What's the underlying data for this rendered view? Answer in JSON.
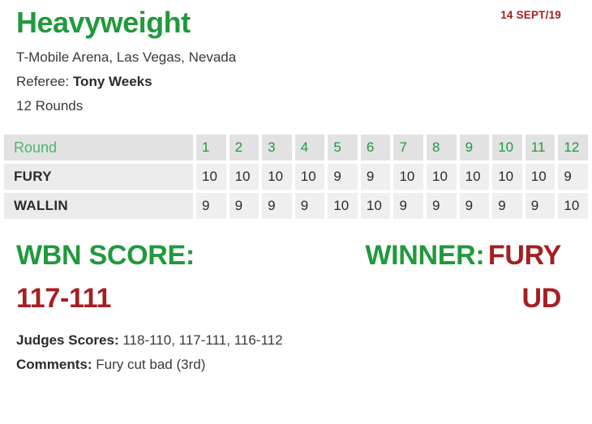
{
  "header": {
    "title": "Heavyweight",
    "date": "14 SEPT/19",
    "venue": "T-Mobile Arena, Las Vegas, Nevada",
    "referee_label": "Referee:",
    "referee_name": "Tony Weeks",
    "rounds": "12 Rounds"
  },
  "table": {
    "round_label": "Round",
    "round_numbers": [
      "1",
      "2",
      "3",
      "4",
      "5",
      "6",
      "7",
      "8",
      "9",
      "10",
      "11",
      "12"
    ],
    "rows": [
      {
        "fighter": "FURY",
        "scores": [
          "10",
          "10",
          "10",
          "10",
          "9",
          "9",
          "10",
          "10",
          "10",
          "10",
          "10",
          "9"
        ]
      },
      {
        "fighter": "WALLIN",
        "scores": [
          "9",
          "9",
          "9",
          "9",
          "10",
          "10",
          "9",
          "9",
          "9",
          "9",
          "9",
          "10"
        ]
      }
    ]
  },
  "result": {
    "wbn_score_label": "WBN SCORE:",
    "wbn_score_value": "117-111",
    "winner_label": "WINNER:",
    "winner_name": "FURY",
    "decision": "UD"
  },
  "notes": {
    "judges_label": "Judges Scores:",
    "judges_value": "118-110, 117-111, 116-112",
    "comments_label": "Comments:",
    "comments_value": "Fury cut bad (3rd)"
  },
  "colors": {
    "green": "#21993c",
    "light_green": "#4fb46f",
    "red": "#a41f23",
    "cell_bg": "#efefef",
    "header_cell_bg": "#e2e2e2"
  }
}
